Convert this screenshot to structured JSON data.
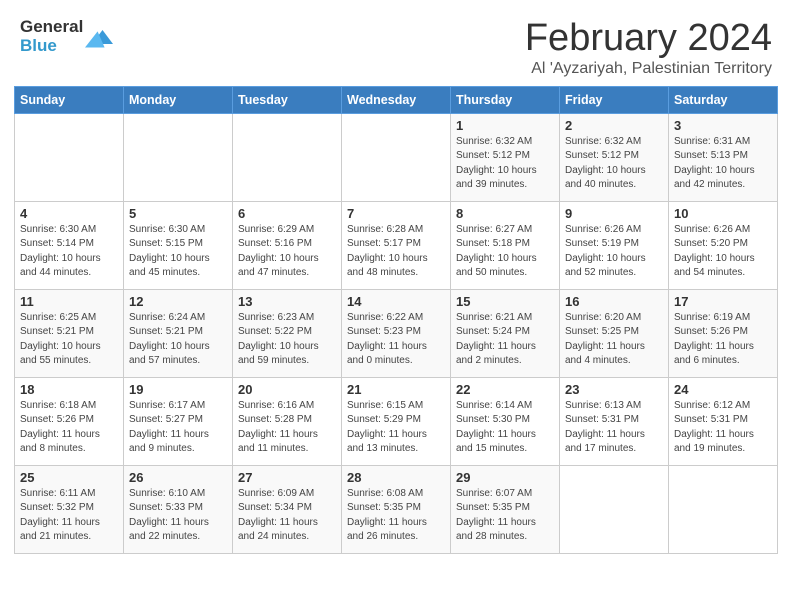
{
  "logo": {
    "general": "General",
    "blue": "Blue"
  },
  "header": {
    "month": "February 2024",
    "location": "Al 'Ayzariyah, Palestinian Territory"
  },
  "days_of_week": [
    "Sunday",
    "Monday",
    "Tuesday",
    "Wednesday",
    "Thursday",
    "Friday",
    "Saturday"
  ],
  "weeks": [
    [
      {
        "day": "",
        "info": ""
      },
      {
        "day": "",
        "info": ""
      },
      {
        "day": "",
        "info": ""
      },
      {
        "day": "",
        "info": ""
      },
      {
        "day": "1",
        "info": "Sunrise: 6:32 AM\nSunset: 5:12 PM\nDaylight: 10 hours\nand 39 minutes."
      },
      {
        "day": "2",
        "info": "Sunrise: 6:32 AM\nSunset: 5:12 PM\nDaylight: 10 hours\nand 40 minutes."
      },
      {
        "day": "3",
        "info": "Sunrise: 6:31 AM\nSunset: 5:13 PM\nDaylight: 10 hours\nand 42 minutes."
      }
    ],
    [
      {
        "day": "4",
        "info": "Sunrise: 6:30 AM\nSunset: 5:14 PM\nDaylight: 10 hours\nand 44 minutes."
      },
      {
        "day": "5",
        "info": "Sunrise: 6:30 AM\nSunset: 5:15 PM\nDaylight: 10 hours\nand 45 minutes."
      },
      {
        "day": "6",
        "info": "Sunrise: 6:29 AM\nSunset: 5:16 PM\nDaylight: 10 hours\nand 47 minutes."
      },
      {
        "day": "7",
        "info": "Sunrise: 6:28 AM\nSunset: 5:17 PM\nDaylight: 10 hours\nand 48 minutes."
      },
      {
        "day": "8",
        "info": "Sunrise: 6:27 AM\nSunset: 5:18 PM\nDaylight: 10 hours\nand 50 minutes."
      },
      {
        "day": "9",
        "info": "Sunrise: 6:26 AM\nSunset: 5:19 PM\nDaylight: 10 hours\nand 52 minutes."
      },
      {
        "day": "10",
        "info": "Sunrise: 6:26 AM\nSunset: 5:20 PM\nDaylight: 10 hours\nand 54 minutes."
      }
    ],
    [
      {
        "day": "11",
        "info": "Sunrise: 6:25 AM\nSunset: 5:21 PM\nDaylight: 10 hours\nand 55 minutes."
      },
      {
        "day": "12",
        "info": "Sunrise: 6:24 AM\nSunset: 5:21 PM\nDaylight: 10 hours\nand 57 minutes."
      },
      {
        "day": "13",
        "info": "Sunrise: 6:23 AM\nSunset: 5:22 PM\nDaylight: 10 hours\nand 59 minutes."
      },
      {
        "day": "14",
        "info": "Sunrise: 6:22 AM\nSunset: 5:23 PM\nDaylight: 11 hours\nand 0 minutes."
      },
      {
        "day": "15",
        "info": "Sunrise: 6:21 AM\nSunset: 5:24 PM\nDaylight: 11 hours\nand 2 minutes."
      },
      {
        "day": "16",
        "info": "Sunrise: 6:20 AM\nSunset: 5:25 PM\nDaylight: 11 hours\nand 4 minutes."
      },
      {
        "day": "17",
        "info": "Sunrise: 6:19 AM\nSunset: 5:26 PM\nDaylight: 11 hours\nand 6 minutes."
      }
    ],
    [
      {
        "day": "18",
        "info": "Sunrise: 6:18 AM\nSunset: 5:26 PM\nDaylight: 11 hours\nand 8 minutes."
      },
      {
        "day": "19",
        "info": "Sunrise: 6:17 AM\nSunset: 5:27 PM\nDaylight: 11 hours\nand 9 minutes."
      },
      {
        "day": "20",
        "info": "Sunrise: 6:16 AM\nSunset: 5:28 PM\nDaylight: 11 hours\nand 11 minutes."
      },
      {
        "day": "21",
        "info": "Sunrise: 6:15 AM\nSunset: 5:29 PM\nDaylight: 11 hours\nand 13 minutes."
      },
      {
        "day": "22",
        "info": "Sunrise: 6:14 AM\nSunset: 5:30 PM\nDaylight: 11 hours\nand 15 minutes."
      },
      {
        "day": "23",
        "info": "Sunrise: 6:13 AM\nSunset: 5:31 PM\nDaylight: 11 hours\nand 17 minutes."
      },
      {
        "day": "24",
        "info": "Sunrise: 6:12 AM\nSunset: 5:31 PM\nDaylight: 11 hours\nand 19 minutes."
      }
    ],
    [
      {
        "day": "25",
        "info": "Sunrise: 6:11 AM\nSunset: 5:32 PM\nDaylight: 11 hours\nand 21 minutes."
      },
      {
        "day": "26",
        "info": "Sunrise: 6:10 AM\nSunset: 5:33 PM\nDaylight: 11 hours\nand 22 minutes."
      },
      {
        "day": "27",
        "info": "Sunrise: 6:09 AM\nSunset: 5:34 PM\nDaylight: 11 hours\nand 24 minutes."
      },
      {
        "day": "28",
        "info": "Sunrise: 6:08 AM\nSunset: 5:35 PM\nDaylight: 11 hours\nand 26 minutes."
      },
      {
        "day": "29",
        "info": "Sunrise: 6:07 AM\nSunset: 5:35 PM\nDaylight: 11 hours\nand 28 minutes."
      },
      {
        "day": "",
        "info": ""
      },
      {
        "day": "",
        "info": ""
      }
    ]
  ]
}
